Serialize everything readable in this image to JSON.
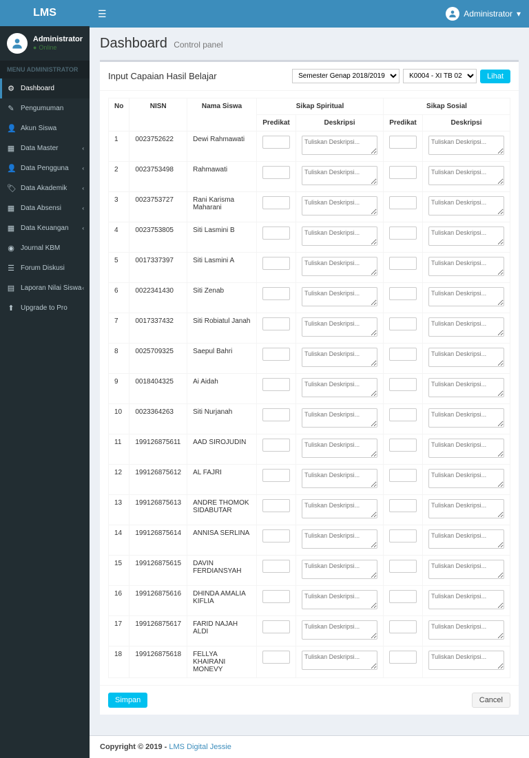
{
  "brand": "LMS",
  "user": {
    "name": "Administrator",
    "status": "Online"
  },
  "top_nav": {
    "user_label": "Administrator"
  },
  "menu_header": "MENU ADMINISTRATOR",
  "menu": [
    {
      "label": "Dashboard",
      "icon": "⚙",
      "active": true,
      "expandable": false
    },
    {
      "label": "Pengumuman",
      "icon": "✎",
      "active": false,
      "expandable": false
    },
    {
      "label": "Akun Siswa",
      "icon": "👤",
      "active": false,
      "expandable": false
    },
    {
      "label": "Data Master",
      "icon": "▦",
      "active": false,
      "expandable": true
    },
    {
      "label": "Data Pengguna",
      "icon": "👤",
      "active": false,
      "expandable": true
    },
    {
      "label": "Data Akademik",
      "icon": "🏷",
      "active": false,
      "expandable": true
    },
    {
      "label": "Data Absensi",
      "icon": "▦",
      "active": false,
      "expandable": true
    },
    {
      "label": "Data Keuangan",
      "icon": "▦",
      "active": false,
      "expandable": true
    },
    {
      "label": "Journal KBM",
      "icon": "◉",
      "active": false,
      "expandable": false
    },
    {
      "label": "Forum Diskusi",
      "icon": "☰",
      "active": false,
      "expandable": false
    },
    {
      "label": "Laporan Nilai Siswa",
      "icon": "▤",
      "active": false,
      "expandable": true
    },
    {
      "label": "Upgrade to Pro",
      "icon": "⬆",
      "active": false,
      "expandable": false
    }
  ],
  "page": {
    "title": "Dashboard",
    "subtitle": "Control panel"
  },
  "box": {
    "title": "Input Capaian Hasil Belajar",
    "semester_options": [
      "Semester Genap 2018/2019"
    ],
    "semester_selected": "Semester Genap 2018/2019",
    "class_options": [
      "K0004 - XI TB 02"
    ],
    "class_selected": "K0004 - XI TB 02",
    "view_button": "Lihat",
    "save_button": "Simpan",
    "cancel_button": "Cancel"
  },
  "table": {
    "group_headers": {
      "spiritual": "Sikap Spiritual",
      "sosial": "Sikap Sosial"
    },
    "headers": {
      "no": "No",
      "nisn": "NISN",
      "nama": "Nama Siswa",
      "predikat": "Predikat",
      "deskripsi": "Deskripsi"
    },
    "deskripsi_placeholder": "Tuliskan Deskripsi...",
    "rows": [
      {
        "no": "1",
        "nisn": "0023752622",
        "nama": "Dewi Rahmawati"
      },
      {
        "no": "2",
        "nisn": "0023753498",
        "nama": "Rahmawati"
      },
      {
        "no": "3",
        "nisn": "0023753727",
        "nama": "Rani Karisma Maharani"
      },
      {
        "no": "4",
        "nisn": "0023753805",
        "nama": "Siti Lasmini B"
      },
      {
        "no": "5",
        "nisn": "0017337397",
        "nama": "Siti Lasmini A"
      },
      {
        "no": "6",
        "nisn": "0022341430",
        "nama": "Siti Zenab"
      },
      {
        "no": "7",
        "nisn": "0017337432",
        "nama": "Siti Robiatul Janah"
      },
      {
        "no": "8",
        "nisn": "0025709325",
        "nama": "Saepul Bahri"
      },
      {
        "no": "9",
        "nisn": "0018404325",
        "nama": "Ai Aidah"
      },
      {
        "no": "10",
        "nisn": "0023364263",
        "nama": "Siti Nurjanah"
      },
      {
        "no": "11",
        "nisn": "199126875611",
        "nama": "AAD SIROJUDIN"
      },
      {
        "no": "12",
        "nisn": "199126875612",
        "nama": "AL FAJRI"
      },
      {
        "no": "13",
        "nisn": "199126875613",
        "nama": "ANDRE THOMOK SIDABUTAR"
      },
      {
        "no": "14",
        "nisn": "199126875614",
        "nama": "ANNISA SERLINA"
      },
      {
        "no": "15",
        "nisn": "199126875615",
        "nama": "DAVIN FERDIANSYAH"
      },
      {
        "no": "16",
        "nisn": "199126875616",
        "nama": "DHINDA AMALIA KIFLIA"
      },
      {
        "no": "17",
        "nisn": "199126875617",
        "nama": "FARID NAJAH ALDI"
      },
      {
        "no": "18",
        "nisn": "199126875618",
        "nama": "FELLYA KHAIRANI MONEVY"
      }
    ]
  },
  "footer": {
    "copyright": "Copyright © 2019 - ",
    "link": "LMS Digital Jessie"
  }
}
